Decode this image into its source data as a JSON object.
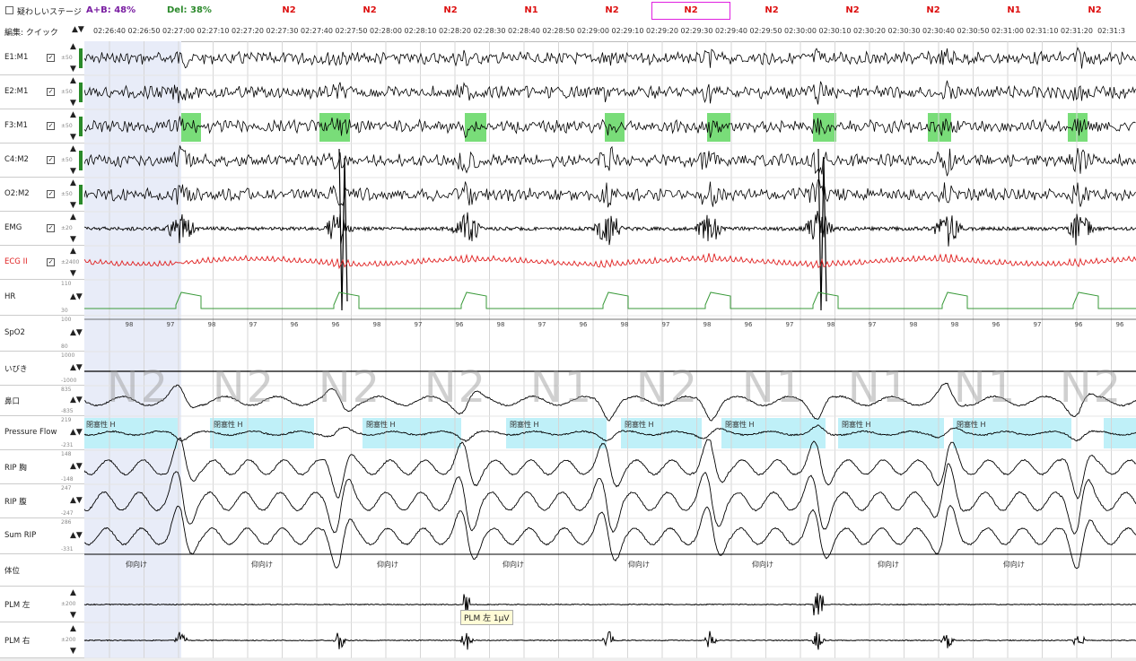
{
  "topbar": {
    "checkbox_label": "疑わしいステージ",
    "ab_ratio": "A+B: 48%",
    "del_ratio": "Del: 38%",
    "stages": [
      "N2",
      "N2",
      "N2",
      "N1",
      "N2",
      "N2",
      "N2",
      "N2",
      "N2",
      "N1",
      "N2"
    ],
    "selected_stage_index": 5
  },
  "timerow": {
    "edit_label": "編集: クイック",
    "arrows": "▲▼",
    "ticks": [
      "02:26:40",
      "02:26:50",
      "02:27:00",
      "02:27:10",
      "02:27:20",
      "02:27:30",
      "02:27:40",
      "02:27:50",
      "02:28:00",
      "02:28:10",
      "02:28:20",
      "02:28:30",
      "02:28:40",
      "02:28:50",
      "02:29:00",
      "02:29:10",
      "02:29:20",
      "02:29:30",
      "02:29:40",
      "02:29:50",
      "02:30:00",
      "02:30:10",
      "02:30:20",
      "02:30:30",
      "02:30:40",
      "02:30:50",
      "02:31:00",
      "02:31:10",
      "02:31:20",
      "02:31:3"
    ]
  },
  "channels": [
    {
      "name": "E1:M1",
      "checkbox": true,
      "scale": "±50"
    },
    {
      "name": "E2:M1",
      "checkbox": true,
      "scale": "±50"
    },
    {
      "name": "F3:M1",
      "checkbox": true,
      "scale": "±50"
    },
    {
      "name": "C4:M2",
      "checkbox": true,
      "scale": "±50"
    },
    {
      "name": "O2:M2",
      "checkbox": true,
      "scale": "±50"
    },
    {
      "name": "EMG",
      "checkbox": true,
      "scale": "±20"
    },
    {
      "name": "ECG II",
      "checkbox": true,
      "scale": "±2400"
    },
    {
      "name": "HR",
      "checkbox": false,
      "scale_top": "110",
      "scale_bottom": "30"
    },
    {
      "name": "SpO2",
      "checkbox": false,
      "scale_top": "100",
      "scale_bottom": "80"
    },
    {
      "name": "いびき",
      "checkbox": false,
      "scale_top": "1000",
      "scale_bottom": "-1000"
    },
    {
      "name": "鼻口",
      "checkbox": false,
      "scale_top": "835",
      "scale_bottom": "-835"
    },
    {
      "name": "Pressure Flow",
      "checkbox": false,
      "scale_top": "219",
      "scale_bottom": "-231"
    },
    {
      "name": "RIP 胸",
      "checkbox": false,
      "scale_top": "148",
      "scale_bottom": "-148"
    },
    {
      "name": "RIP 腹",
      "checkbox": false,
      "scale_top": "247",
      "scale_bottom": "-247"
    },
    {
      "name": "Sum RIP",
      "checkbox": false,
      "scale_top": "286",
      "scale_bottom": "-331"
    },
    {
      "name": "体位",
      "checkbox": false
    },
    {
      "name": "PLM 左",
      "checkbox": false,
      "scale": "±200"
    },
    {
      "name": "PLM 右",
      "checkbox": false,
      "scale": "±200"
    }
  ],
  "big_stages": [
    "N2",
    "N2",
    "N2",
    "N2",
    "N1",
    "N2",
    "N1",
    "N1",
    "N1",
    "N2"
  ],
  "hypopnea_label": "閉塞性 H",
  "body_position_label": "仰向け",
  "spo2_values": [
    "98",
    "97",
    "98",
    "97",
    "96",
    "96",
    "98",
    "97",
    "96",
    "98",
    "97",
    "96",
    "98",
    "97",
    "98",
    "96",
    "97",
    "98",
    "97",
    "98",
    "98",
    "96",
    "97",
    "96",
    "96"
  ],
  "tooltip": "PLM 左 1μV",
  "colors": {
    "ecg": "#e02020",
    "hr": "#3a9a3a",
    "spindle": "#4cd24c",
    "hypopnea": "#bff0f8",
    "selection": "#e020e0"
  }
}
